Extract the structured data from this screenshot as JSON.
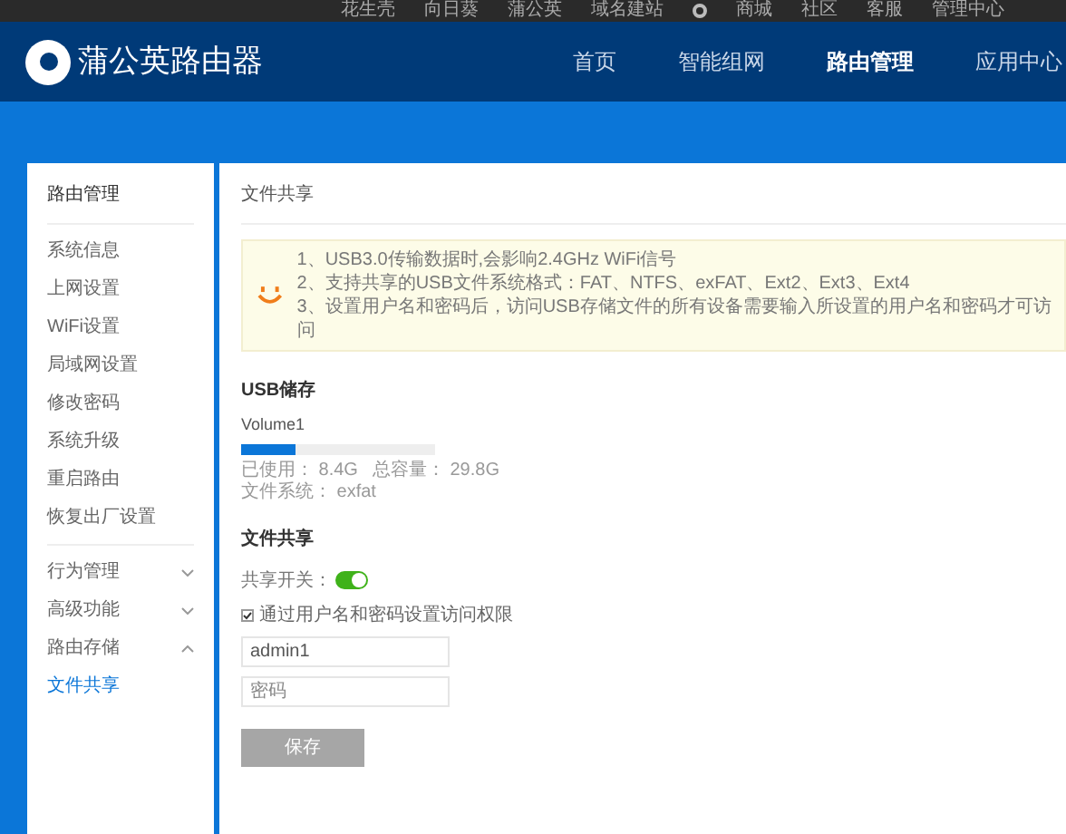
{
  "top_links": [
    "花生壳",
    "向日葵",
    "蒲公英",
    "域名建站",
    "商城",
    "社区",
    "客服",
    "管理中心"
  ],
  "header": {
    "brand": "蒲公英路由器",
    "nav": [
      {
        "label": "首页",
        "selected": false
      },
      {
        "label": "智能组网",
        "selected": false
      },
      {
        "label": "路由管理",
        "selected": true
      },
      {
        "label": "应用中心",
        "selected": false
      }
    ]
  },
  "sidebar": {
    "title": "路由管理",
    "items": [
      {
        "label": "系统信息",
        "selected": false
      },
      {
        "label": "上网设置",
        "selected": false
      },
      {
        "label": "WiFi设置",
        "selected": false
      },
      {
        "label": "局域网设置",
        "selected": false
      },
      {
        "label": "修改密码",
        "selected": false
      },
      {
        "label": "系统升级",
        "selected": false
      },
      {
        "label": "重启路由",
        "selected": false
      },
      {
        "label": "恢复出厂设置",
        "selected": false
      }
    ],
    "groups": [
      {
        "label": "行为管理",
        "expanded": false
      },
      {
        "label": "高级功能",
        "expanded": false
      },
      {
        "label": "路由存储",
        "expanded": true,
        "children": [
          {
            "label": "文件共享",
            "selected": true
          }
        ]
      }
    ]
  },
  "page_title": "文件共享",
  "notice": [
    "1、USB3.0传输数据时,会影响2.4GHz WiFi信号",
    "2、支持共享的USB文件系统格式：FAT、NTFS、exFAT、Ext2、Ext3、Ext4",
    "3、设置用户名和密码后，访问USB存储文件的所有设备需要输入所设置的用户名和密码才可访问"
  ],
  "usb": {
    "heading": "USB储存",
    "volume": "Volume1",
    "level": 0.28,
    "used": "已使用： 8.4G",
    "total": "总容量： 29.8G",
    "filesystem": "文件系统： exfat"
  },
  "share": {
    "heading": "文件共享",
    "switch_label": "共享开关：",
    "switch_on": true,
    "auth_label": "通过用户名和密码设置访问权限",
    "auth_checked": true,
    "username": "admin1",
    "password_placeholder": "密码",
    "save": "保存",
    "save_disabled": true
  }
}
